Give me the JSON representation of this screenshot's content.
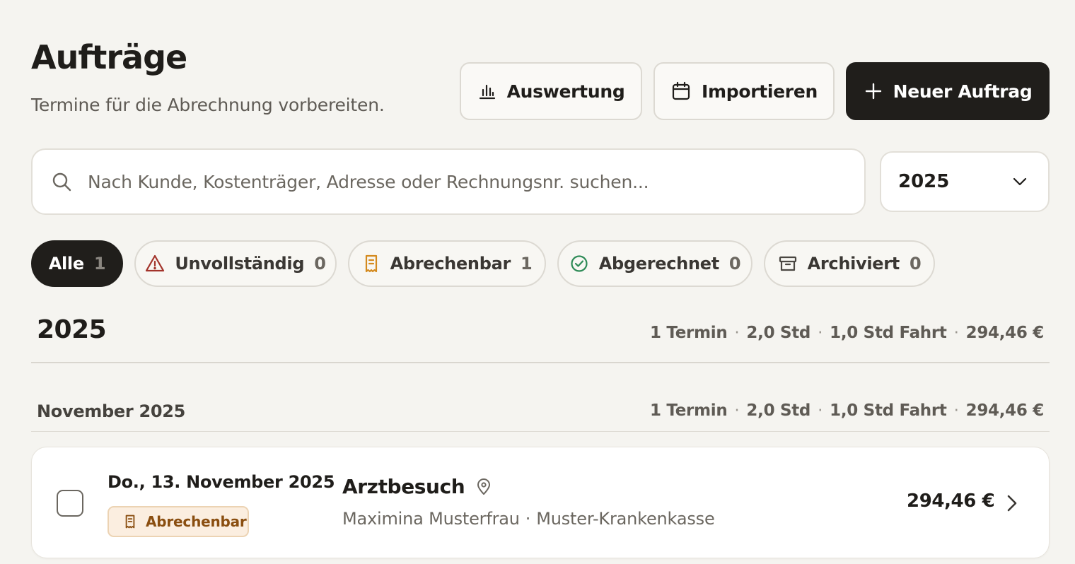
{
  "header": {
    "title": "Aufträge",
    "subtitle": "Termine für die Abrechnung vorbereiten."
  },
  "toolbar": {
    "auswertung_label": "Auswertung",
    "import_label": "Importieren",
    "new_label": "Neuer Auftrag"
  },
  "search": {
    "placeholder": "Nach Kunde, Kostenträger, Adresse oder Rechnungsnr. suchen...",
    "value": ""
  },
  "year_filter": {
    "selected": "2025"
  },
  "filters": [
    {
      "label": "Alle",
      "count": "1",
      "icon": "none",
      "active": true
    },
    {
      "label": "Unvollständig",
      "count": "0",
      "icon": "warning-icon"
    },
    {
      "label": "Abrechenbar",
      "count": "1",
      "icon": "receipt-icon"
    },
    {
      "label": "Abgerechnet",
      "count": "0",
      "icon": "check-circle-icon"
    },
    {
      "label": "Archiviert",
      "count": "0",
      "icon": "archive-icon"
    }
  ],
  "year_group": {
    "year": "2025",
    "summary": {
      "termine": "1 Termin",
      "hours": "2,0 Std",
      "travel": "1,0 Std Fahrt",
      "total": "294,46 €"
    }
  },
  "month_group": {
    "month": "November 2025",
    "summary": {
      "termine": "1 Termin",
      "hours": "2,0 Std",
      "travel": "1,0 Std Fahrt",
      "total": "294,46 €"
    }
  },
  "appointment": {
    "date": "Do., 13. November 2025",
    "status": "Abrechenbar",
    "title": "Arztbesuch",
    "customer": "Maximina Musterfrau",
    "separator": "·",
    "payer": "Muster-Krankenkasse",
    "amount": "294,46 €"
  },
  "colors": {
    "background": "#f5f4f0",
    "primary_dark": "#201e1b",
    "warning": "#a3342b",
    "receipt": "#d48a1e",
    "success": "#2e8b57",
    "badge_bg": "#fbeee0",
    "badge_text": "#8a4e10"
  },
  "separator_dot": "·"
}
